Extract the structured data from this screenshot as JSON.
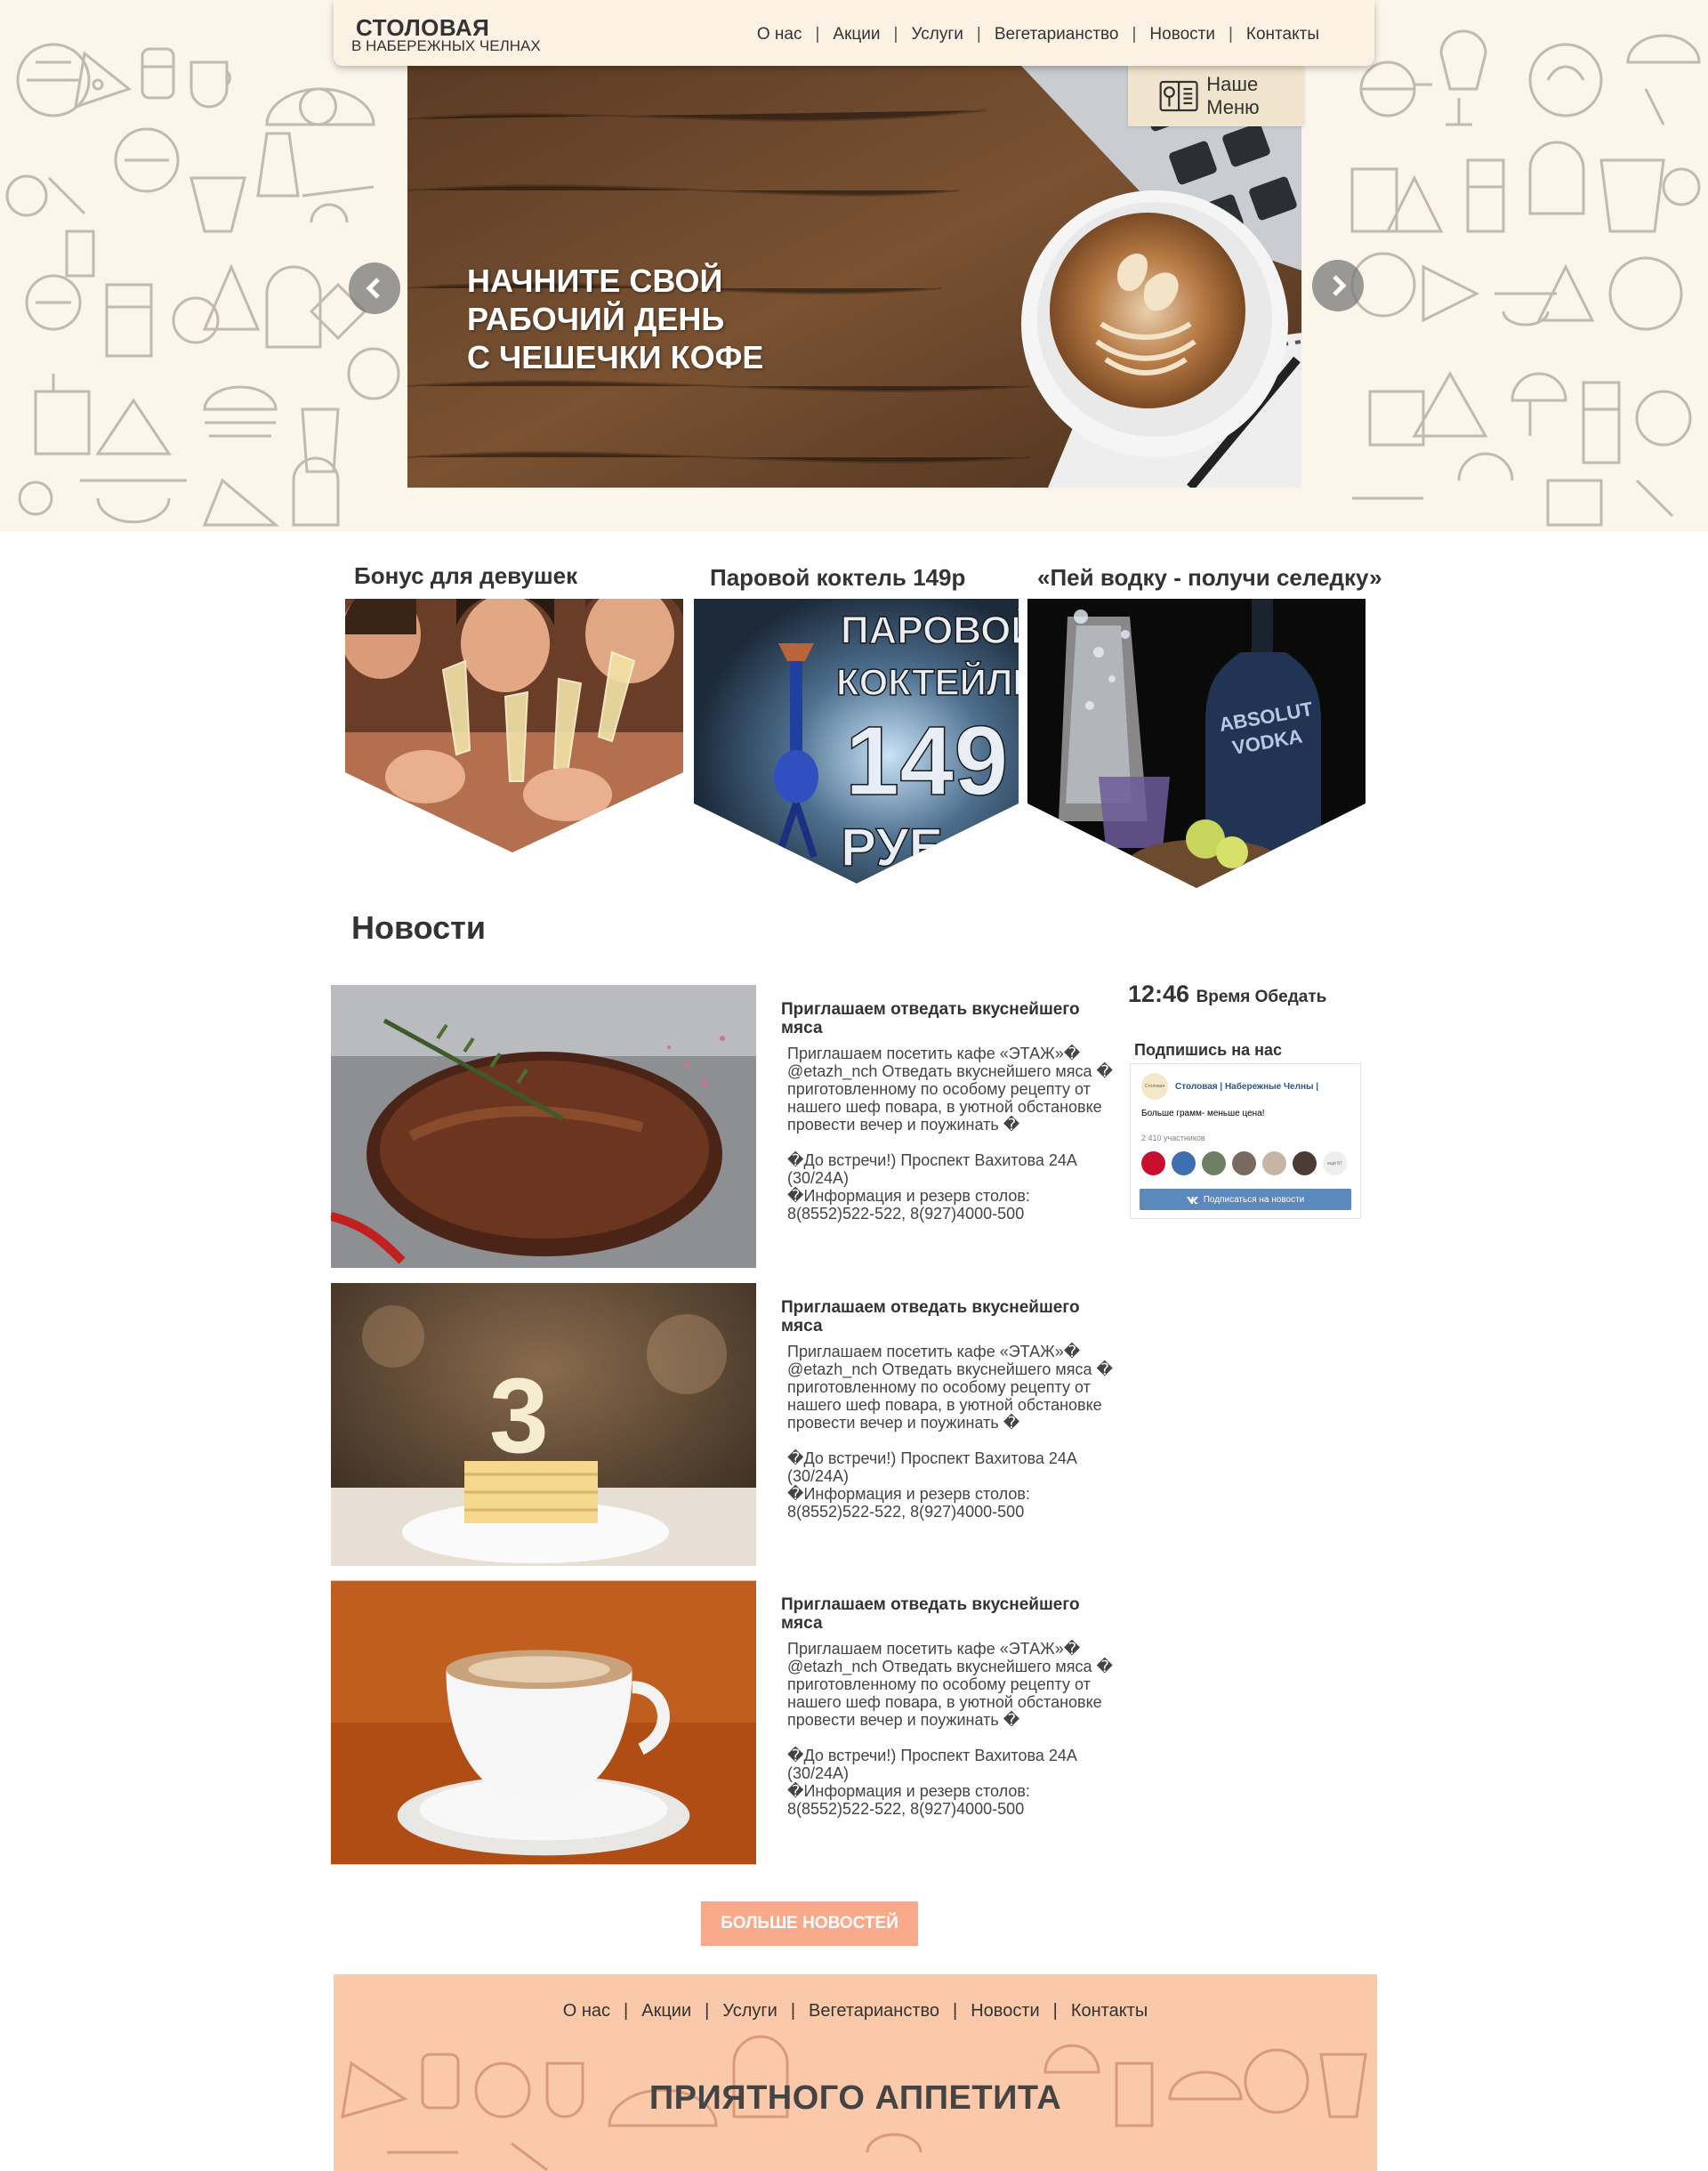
{
  "header": {
    "logo_title": "СТОЛОВАЯ",
    "logo_subtitle": "В НАБЕРЕЖНЫХ ЧЕЛНАХ",
    "nav": [
      "О нас",
      "Акции",
      "Услуги",
      "Вегетарианство",
      "Новости",
      "Контакты"
    ],
    "menu_button": "Наше Меню"
  },
  "slider": {
    "caption_line1": "НАЧНИТЕ СВОЙ",
    "caption_line2": "РАБОЧИЙ ДЕНЬ",
    "caption_line3": "С ЧЕШЕЧКИ КОФЕ"
  },
  "promos": [
    {
      "title": "Бонус для девушек"
    },
    {
      "title": "Паровой коктель 149р",
      "image_text_1": "ПАРОВОЙ",
      "image_text_2": "КОКТЕЙЛЬ",
      "image_text_3": "149",
      "image_text_4": "РУБ"
    },
    {
      "title": "«Пей водку - получи селедку»",
      "image_text_1": "ABSOLUT",
      "image_text_2": "VODKA"
    }
  ],
  "news": {
    "heading": "Новости",
    "items": [
      {
        "title": "Приглашаем отведать вкуснейшего мяса",
        "text_1": "Приглашаем посетить кафе «ЭТАЖ»� @etazh_nch Отведать вкуснейшего мяса � приготовленному по особому рецепту от нашего шеф повара, в уютной обстановке провести вечер и поужинать �",
        "text_2": "�До встречи!) Проспект Вахитова 24А (30/24А)",
        "text_3": "�Информация и резерв столов: 8(8552)522-522, 8(927)4000-500"
      },
      {
        "title": "Приглашаем отведать вкуснейшего мяса",
        "text_1": "Приглашаем посетить кафе «ЭТАЖ»� @etazh_nch Отведать вкуснейшего мяса � приготовленному по особому рецепту от нашего шеф повара, в уютной обстановке провести вечер и поужинать �",
        "text_2": "�До встречи!) Проспект Вахитова 24А (30/24А)",
        "text_3": "�Информация и резерв столов: 8(8552)522-522, 8(927)4000-500"
      },
      {
        "title": "Приглашаем отведать вкуснейшего мяса",
        "text_1": "Приглашаем посетить кафе «ЭТАЖ»� @etazh_nch Отведать вкуснейшего мяса � приготовленному по особому рецепту от нашего шеф повара, в уютной обстановке провести вечер и поужинать �",
        "text_2": "�До встречи!) Проспект Вахитова 24А (30/24А)",
        "text_3": "�Информация и резерв столов: 8(8552)522-522, 8(927)4000-500"
      }
    ],
    "more_button": "БОЛЬШЕ НОВОСТЕЙ"
  },
  "sidebar": {
    "time": "12:46",
    "time_label": "Время Обедать",
    "subscribe_label": "Подпишись на нас",
    "vk": {
      "logo_text": "Столовая",
      "group_name": "Столовая | Набережные Челны |",
      "status": "Больше грамм- меньше цена!",
      "members": "2 410 участников",
      "last_avatar_text": "ещё 57",
      "button": "Подписаться на новости"
    }
  },
  "footer": {
    "nav": [
      "О нас",
      "Акции",
      "Услуги",
      "Вегетарианство",
      "Новости",
      "Контакты"
    ],
    "slogan": "ПРИЯТНОГО АППЕТИТА"
  },
  "colors": {
    "hero_bg": "#fbf5ea",
    "topbar_bg": "#fcf2e4",
    "accent_button": "#f7a98a",
    "footer_bg": "#f9c9a9",
    "vk_blue": "#5b88bd",
    "text": "#333333"
  },
  "icons": [
    "menu-book-icon",
    "chevron-left-icon",
    "chevron-right-icon",
    "vk-icon"
  ]
}
